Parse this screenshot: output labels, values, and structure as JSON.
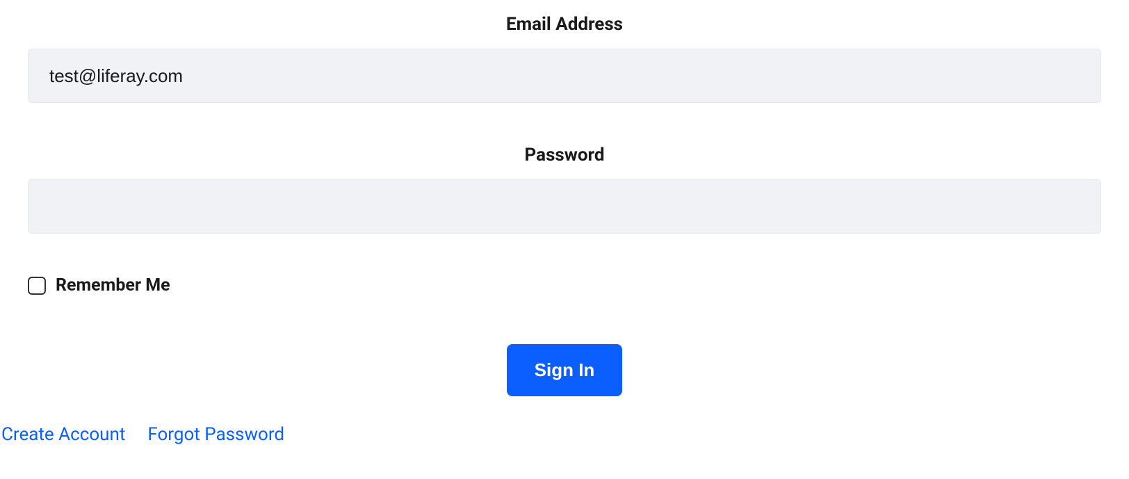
{
  "form": {
    "emailLabel": "Email Address",
    "emailValue": "test@liferay.com",
    "passwordLabel": "Password",
    "passwordValue": "",
    "rememberLabel": "Remember Me",
    "signInLabel": "Sign In"
  },
  "links": {
    "createAccount": "Create Account",
    "forgotPassword": "Forgot Password"
  }
}
